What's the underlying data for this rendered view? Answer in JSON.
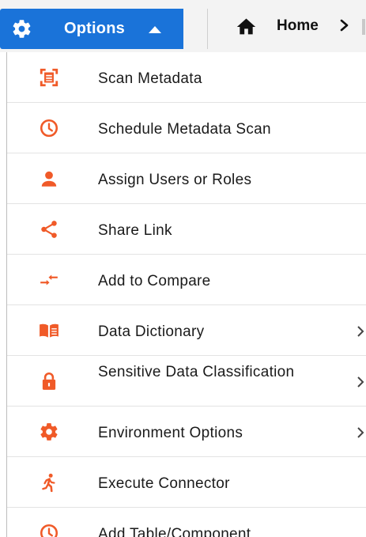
{
  "toolbar": {
    "options_label": "Options",
    "home_label": "Home",
    "home_separator": ">"
  },
  "colors": {
    "accent_blue": "#1a73d9",
    "icon_orange": "#f05a28"
  },
  "menu": {
    "items": [
      {
        "label": "Scan Metadata",
        "icon": "scan-icon",
        "has_submenu": false
      },
      {
        "label": "Schedule Metadata Scan",
        "icon": "clock-icon",
        "has_submenu": false
      },
      {
        "label": "Assign Users or Roles",
        "icon": "user-icon",
        "has_submenu": false
      },
      {
        "label": "Share Link",
        "icon": "share-icon",
        "has_submenu": false
      },
      {
        "label": "Add to Compare",
        "icon": "compare-arrows-icon",
        "has_submenu": false
      },
      {
        "label": "Data Dictionary",
        "icon": "book-icon",
        "has_submenu": true
      },
      {
        "label": "Sensitive Data Classification",
        "icon": "lock-icon",
        "has_submenu": true
      },
      {
        "label": "Environment Options",
        "icon": "gear-icon",
        "has_submenu": true
      },
      {
        "label": "Execute Connector",
        "icon": "running-person-icon",
        "has_submenu": false
      },
      {
        "label": "Add Table/Component",
        "icon": "clock-icon",
        "has_submenu": false
      }
    ]
  }
}
